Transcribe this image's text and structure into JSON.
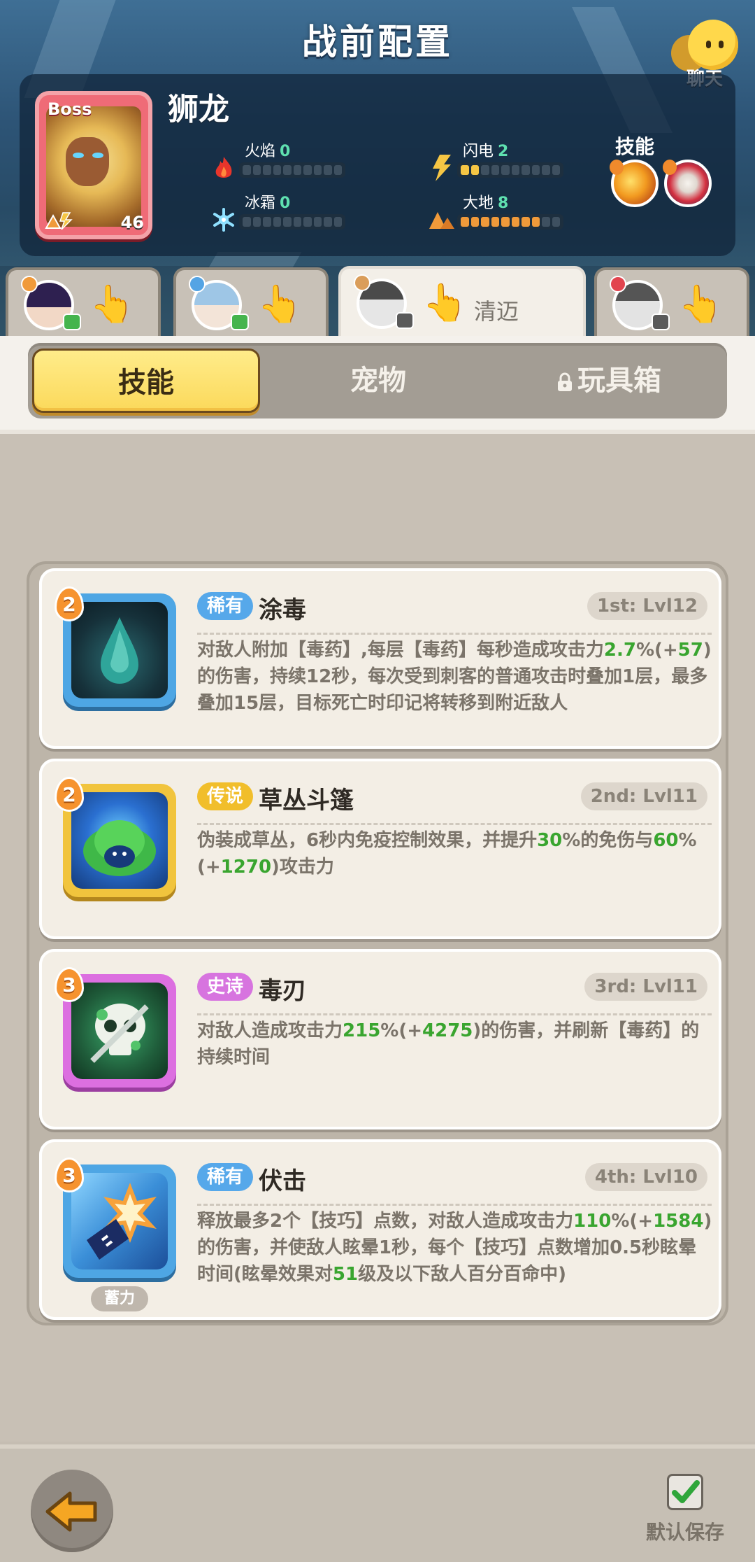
{
  "header": {
    "title": "战前配置",
    "chat_label": "聊天"
  },
  "boss": {
    "badge": "Boss",
    "name": "狮龙",
    "level": "46",
    "stats": [
      {
        "name": "火焰",
        "value": "0",
        "filled": 0,
        "icon": "fire-icon",
        "color": "#e8352b"
      },
      {
        "name": "闪电",
        "value": "2",
        "filled": 2,
        "icon": "lightning-icon",
        "color": "#f6c644"
      },
      {
        "name": "冰霜",
        "value": "0",
        "filled": 0,
        "icon": "snowflake-icon",
        "color": "#7fd6ff"
      },
      {
        "name": "大地",
        "value": "8",
        "filled": 8,
        "icon": "earth-icon",
        "color": "#f09a3a"
      }
    ],
    "skills_label": "技能"
  },
  "characters": [
    {
      "name": "",
      "active": false
    },
    {
      "name": "",
      "active": false
    },
    {
      "name": "清迈",
      "active": true
    },
    {
      "name": "",
      "active": false
    }
  ],
  "tabs": [
    {
      "label": "技能",
      "active": true
    },
    {
      "label": "宠物",
      "active": false
    },
    {
      "label": "玩具箱",
      "active": false,
      "locked": true
    }
  ],
  "skills": [
    {
      "count": "2",
      "rarity": "稀有",
      "rarity_type": "rare",
      "name": "涂毒",
      "slot": "1st: Lvl12",
      "desc": [
        {
          "t": "对敌人附加【毒药】,每层【毒药】每秒造成攻击力"
        },
        {
          "t": "2.7",
          "g": true
        },
        {
          "t": "%(+"
        },
        {
          "t": "57",
          "g": true
        },
        {
          "t": ")的伤害，持续12秒，每次受到刺客的普通攻击时叠加1层，最多叠加15层，目标死亡时印记将转移到附近敌人"
        }
      ]
    },
    {
      "count": "2",
      "rarity": "传说",
      "rarity_type": "legend",
      "name": "草丛斗篷",
      "slot": "2nd: Lvl11",
      "desc": [
        {
          "t": "伪装成草丛，6秒内免疫控制效果，并提升"
        },
        {
          "t": "30",
          "g": true
        },
        {
          "t": "%的免伤与"
        },
        {
          "t": "60",
          "g": true
        },
        {
          "t": "%(+"
        },
        {
          "t": "1270",
          "g": true
        },
        {
          "t": ")攻击力"
        }
      ]
    },
    {
      "count": "3",
      "rarity": "史诗",
      "rarity_type": "epic",
      "name": "毒刃",
      "slot": "3rd: Lvl11",
      "desc": [
        {
          "t": "对敌人造成攻击力"
        },
        {
          "t": "215",
          "g": true
        },
        {
          "t": "%(+"
        },
        {
          "t": "4275",
          "g": true
        },
        {
          "t": ")的伤害，并刷新【毒药】的持续时间"
        }
      ]
    },
    {
      "count": "3",
      "rarity": "稀有",
      "rarity_type": "rare",
      "name": "伏击",
      "slot": "4th: Lvl10",
      "sub_tag": "蓄力",
      "desc": [
        {
          "t": "释放最多2个【技巧】点数，对敌人造成攻击力"
        },
        {
          "t": "110",
          "g": true
        },
        {
          "t": "%(+"
        },
        {
          "t": "1584",
          "g": true
        },
        {
          "t": ")的伤害，并使敌人眩晕1秒，每个【技巧】点数增加0.5秒眩晕时间(眩晕效果对"
        },
        {
          "t": "51",
          "g": true
        },
        {
          "t": "级及以下敌人百分百命中)"
        }
      ]
    }
  ],
  "footer": {
    "default_save_label": "默认保存"
  }
}
